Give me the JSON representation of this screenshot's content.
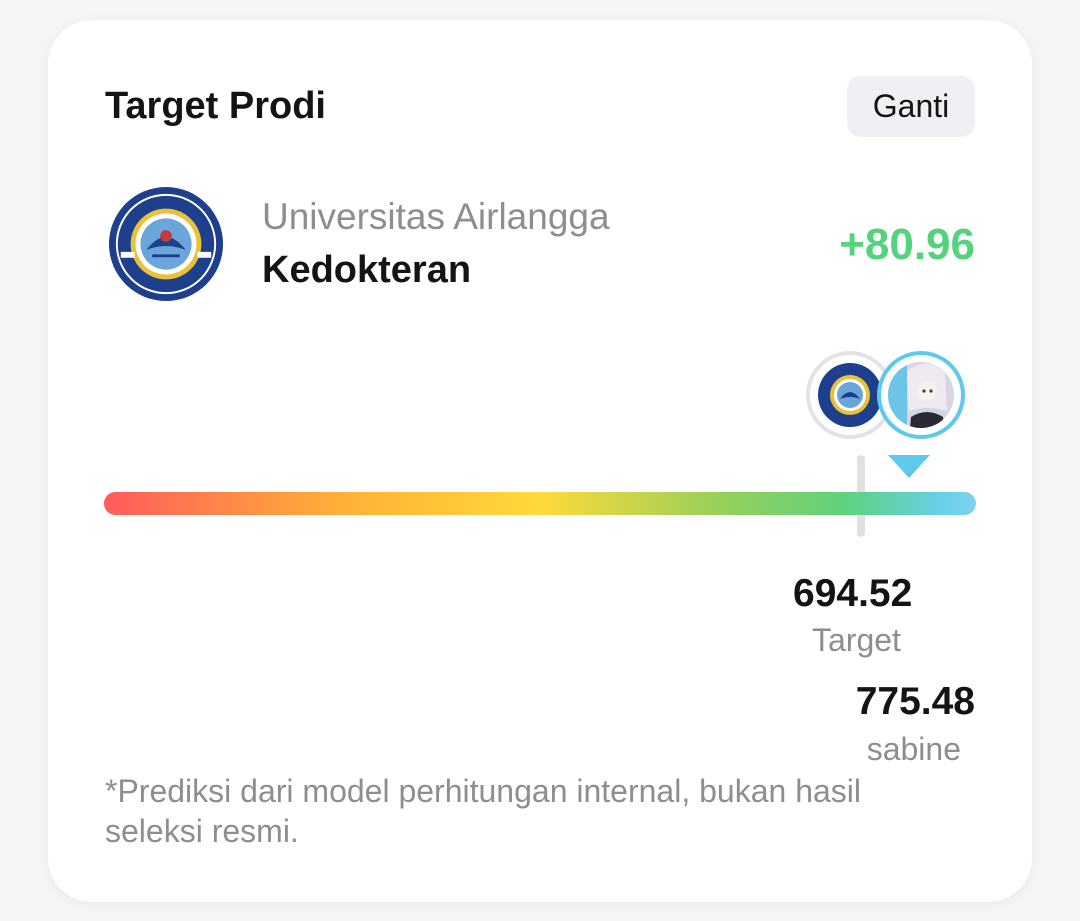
{
  "card": {
    "title": "Target Prodi",
    "change_button": "Ganti"
  },
  "program": {
    "university": "Universitas Airlangga",
    "major": "Kedokteran",
    "score_difference": "+80.96",
    "logo_icon": "unair-seal-icon",
    "logo_text": "UNIVERSITAS AIRLANGGA · UNAIR"
  },
  "scale": {
    "target_score": "694.52",
    "target_label": "Target",
    "user_score": "775.48",
    "user_label": "sabine",
    "user_avatar": "user-avatar-icon"
  },
  "disclaimer": "*Prediksi dari model perhitungan internal, bukan hasil seleksi resmi.",
  "colors": {
    "accent_green": "#55d27c",
    "pointer_blue": "#5fc9ec",
    "seal_blue": "#1d3f8c",
    "seal_gold": "#e9c23a"
  }
}
